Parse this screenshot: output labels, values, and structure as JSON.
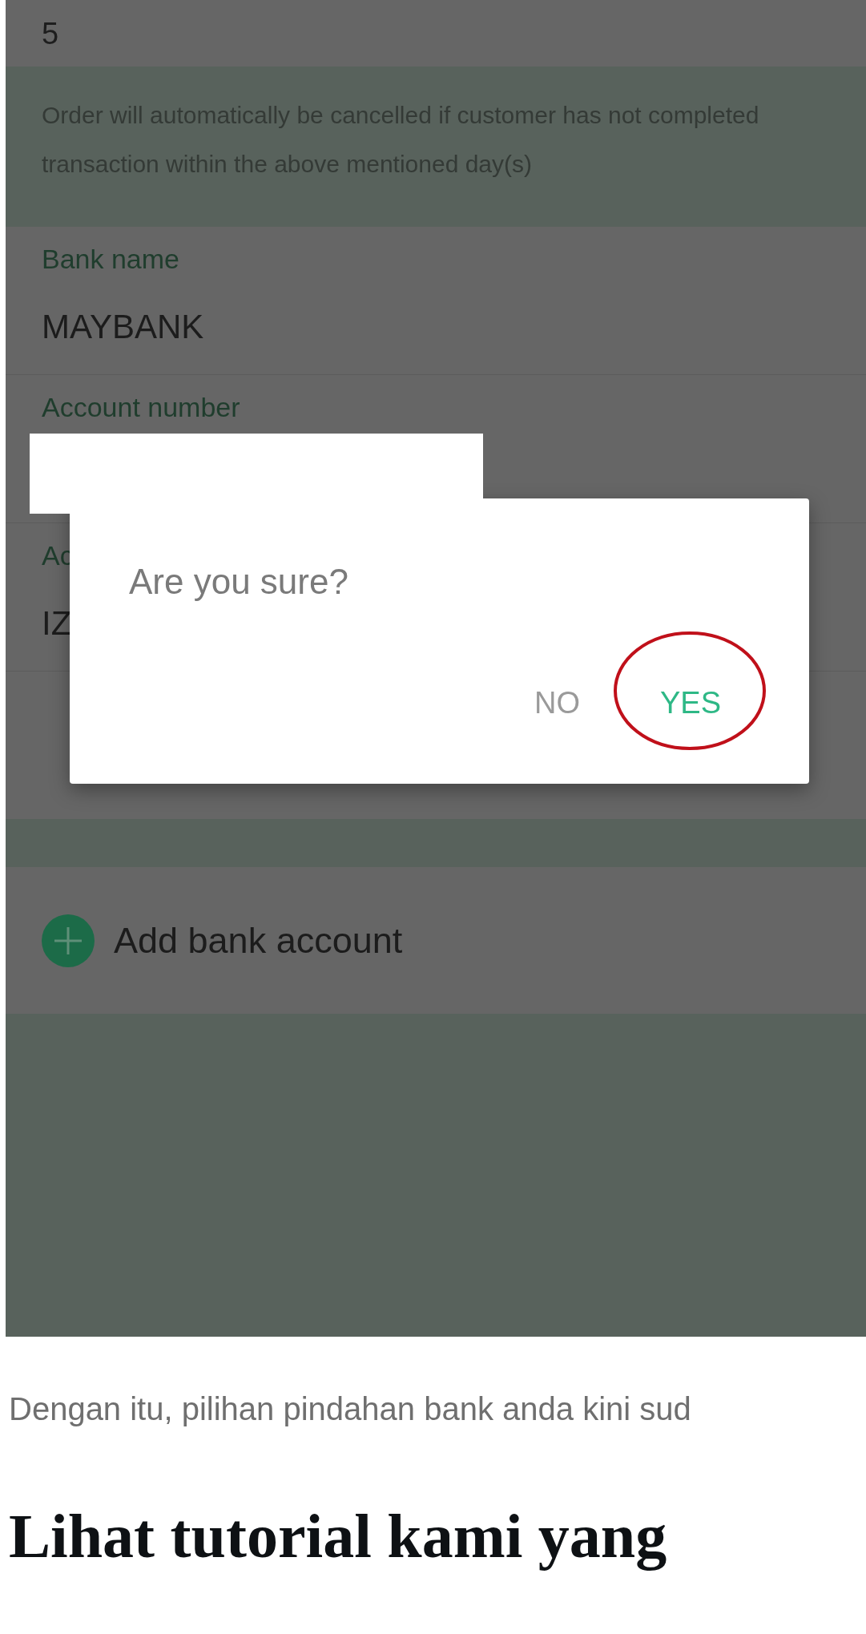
{
  "app": {
    "quantity_value": "5",
    "notice": "Order will automatically be cancelled if customer has not completed transaction within the above mentioned day(s)",
    "fields": [
      {
        "label": "Bank name",
        "value": "MAYBANK"
      },
      {
        "label": "Account number",
        "redacted": true
      },
      {
        "label": "Ac",
        "value": "IZ"
      }
    ],
    "add_button": "Add bank account"
  },
  "dialog": {
    "message": "Are you sure?",
    "buttons": [
      {
        "label": "NO",
        "kind": "negative",
        "circled": false
      },
      {
        "label": "YES",
        "kind": "positive",
        "circled": true
      }
    ]
  },
  "article": {
    "paragraph": "Dengan itu, pilihan pindahan bank anda kini sud",
    "heading": "Lihat tutorial kami yang"
  }
}
